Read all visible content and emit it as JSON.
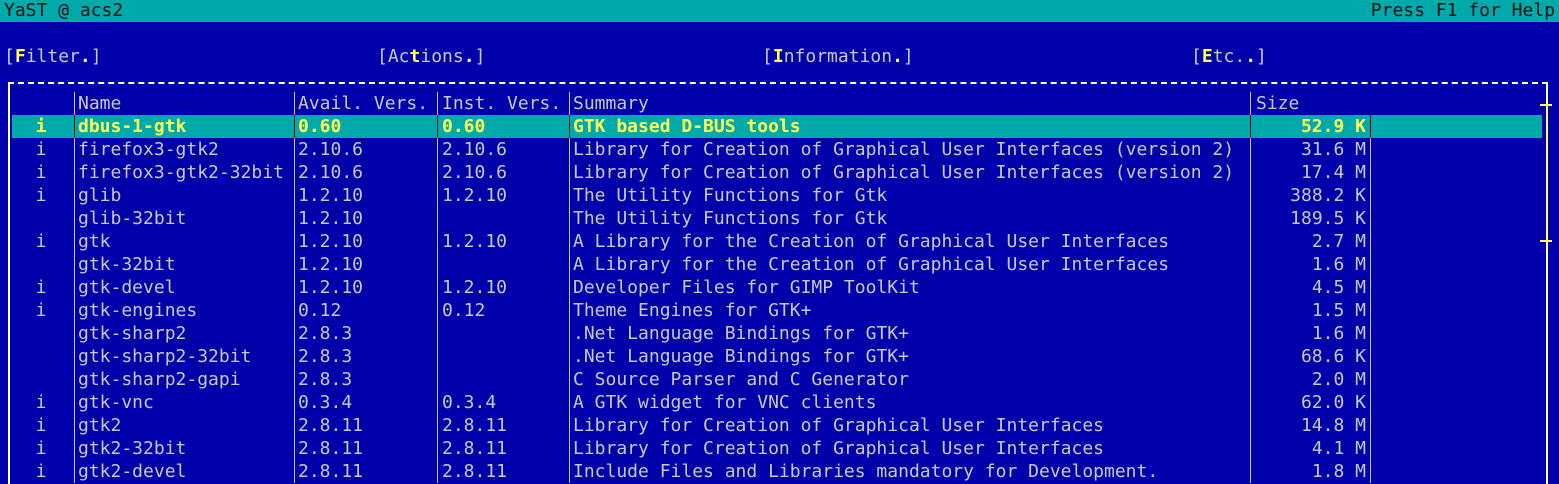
{
  "titlebar": {
    "title": "YaST @ acs2",
    "help": "Press F1 for Help"
  },
  "menu": [
    {
      "open": "[",
      "hot": "F",
      "rest": "ilter",
      "dot": ".",
      "close": "]"
    },
    {
      "open": "[Ac",
      "hot": "t",
      "rest": "ions",
      "dot": ".",
      "close": "]"
    },
    {
      "open": "[",
      "hot": "I",
      "rest": "nformation",
      "dot": ".",
      "close": "]"
    },
    {
      "open": "[",
      "hot": "E",
      "rest": "tc.",
      "dot": ".",
      "close": "]"
    }
  ],
  "table": {
    "headers": {
      "name": "Name",
      "avail": "Avail. Vers.",
      "inst": "Inst. Vers.",
      "summary": "Summary",
      "size": "Size"
    },
    "rows": [
      {
        "status": "i",
        "name": "dbus-1-gtk",
        "avail": "0.60",
        "inst": "0.60",
        "summary": "GTK based D-BUS tools",
        "size": "52.9 K"
      },
      {
        "status": "i",
        "name": "firefox3-gtk2",
        "avail": "2.10.6",
        "inst": "2.10.6",
        "summary": "Library for Creation of Graphical User Interfaces (version 2)",
        "size": "31.6 M"
      },
      {
        "status": "i",
        "name": "firefox3-gtk2-32bit",
        "avail": "2.10.6",
        "inst": "2.10.6",
        "summary": "Library for Creation of Graphical User Interfaces (version 2)",
        "size": "17.4 M"
      },
      {
        "status": "i",
        "name": "glib",
        "avail": "1.2.10",
        "inst": "1.2.10",
        "summary": "The Utility Functions for Gtk",
        "size": "388.2 K"
      },
      {
        "status": "",
        "name": "glib-32bit",
        "avail": "1.2.10",
        "inst": "",
        "summary": "The Utility Functions for Gtk",
        "size": "189.5 K"
      },
      {
        "status": "i",
        "name": "gtk",
        "avail": "1.2.10",
        "inst": "1.2.10",
        "summary": "A Library for the Creation of Graphical User Interfaces",
        "size": "2.7 M"
      },
      {
        "status": "",
        "name": "gtk-32bit",
        "avail": "1.2.10",
        "inst": "",
        "summary": "A Library for the Creation of Graphical User Interfaces",
        "size": "1.6 M"
      },
      {
        "status": "i",
        "name": "gtk-devel",
        "avail": "1.2.10",
        "inst": "1.2.10",
        "summary": "Developer Files for GIMP ToolKit",
        "size": "4.5 M"
      },
      {
        "status": "i",
        "name": "gtk-engines",
        "avail": "0.12",
        "inst": "0.12",
        "summary": "Theme Engines for GTK+",
        "size": "1.5 M"
      },
      {
        "status": "",
        "name": "gtk-sharp2",
        "avail": "2.8.3",
        "inst": "",
        "summary": ".Net Language Bindings for GTK+",
        "size": "1.6 M"
      },
      {
        "status": "",
        "name": "gtk-sharp2-32bit",
        "avail": "2.8.3",
        "inst": "",
        "summary": ".Net Language Bindings for GTK+",
        "size": "68.6 K"
      },
      {
        "status": "",
        "name": "gtk-sharp2-gapi",
        "avail": "2.8.3",
        "inst": "",
        "summary": "C Source Parser and C Generator",
        "size": "2.0 M"
      },
      {
        "status": "i",
        "name": "gtk-vnc",
        "avail": "0.3.4",
        "inst": "0.3.4",
        "summary": "A GTK widget for VNC clients",
        "size": "62.0 K"
      },
      {
        "status": "i",
        "name": "gtk2",
        "avail": "2.8.11",
        "inst": "2.8.11",
        "summary": "Library for Creation of Graphical User Interfaces",
        "size": "14.8 M"
      },
      {
        "status": "i",
        "name": "gtk2-32bit",
        "avail": "2.8.11",
        "inst": "2.8.11",
        "summary": "Library for Creation of Graphical User Interfaces",
        "size": "4.1 M"
      },
      {
        "status": "i",
        "name": "gtk2-devel",
        "avail": "2.8.11",
        "inst": "2.8.11",
        "summary": "Include Files and Libraries mandatory for Development.",
        "size": "1.8 M"
      }
    ]
  }
}
